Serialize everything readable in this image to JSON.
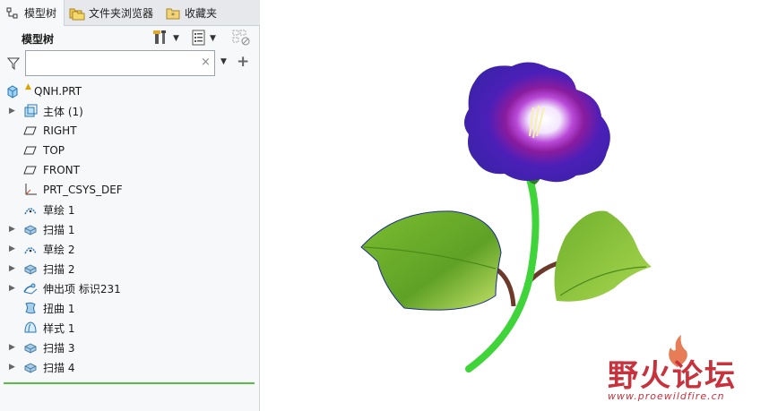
{
  "tabs": [
    {
      "label": "模型树",
      "icon": "model-tree-icon",
      "active": true
    },
    {
      "label": "文件夹浏览器",
      "icon": "folder-browser-icon",
      "active": false
    },
    {
      "label": "收藏夹",
      "icon": "favorites-icon",
      "active": false
    }
  ],
  "panel": {
    "title": "模型树"
  },
  "filter": {
    "value": "",
    "placeholder": "",
    "clear": "×",
    "add": "+"
  },
  "tree": {
    "root": {
      "label": "QNH.PRT",
      "icon": "part-icon"
    },
    "items": [
      {
        "label": "主体 (1)",
        "icon": "body-icon",
        "expandable": true
      },
      {
        "label": "RIGHT",
        "icon": "datum-plane-icon",
        "expandable": false
      },
      {
        "label": "TOP",
        "icon": "datum-plane-icon",
        "expandable": false
      },
      {
        "label": "FRONT",
        "icon": "datum-plane-icon",
        "expandable": false
      },
      {
        "label": "PRT_CSYS_DEF",
        "icon": "csys-icon",
        "expandable": false
      },
      {
        "label": "草绘 1",
        "icon": "sketch-icon",
        "expandable": false
      },
      {
        "label": "扫描 1",
        "icon": "sweep-icon",
        "expandable": true
      },
      {
        "label": "草绘 2",
        "icon": "sketch-icon",
        "expandable": true
      },
      {
        "label": "扫描 2",
        "icon": "sweep-icon",
        "expandable": true
      },
      {
        "label": "伸出项 标识231",
        "icon": "protrusion-icon",
        "expandable": true
      },
      {
        "label": "扭曲 1",
        "icon": "warp-icon",
        "expandable": false
      },
      {
        "label": "样式 1",
        "icon": "style-icon",
        "expandable": false
      },
      {
        "label": "扫描 3",
        "icon": "sweep-icon",
        "expandable": true
      },
      {
        "label": "扫描 4",
        "icon": "sweep-icon",
        "expandable": true
      }
    ]
  },
  "watermark": {
    "title": "野火论坛",
    "url": "www.proewildfire.cn"
  },
  "colors": {
    "accent_green": "#5cba47",
    "watermark_red": "#c8323c",
    "petal": "#4b1fb8",
    "leaf": "#6fb02c",
    "stem": "#3fd43a"
  }
}
